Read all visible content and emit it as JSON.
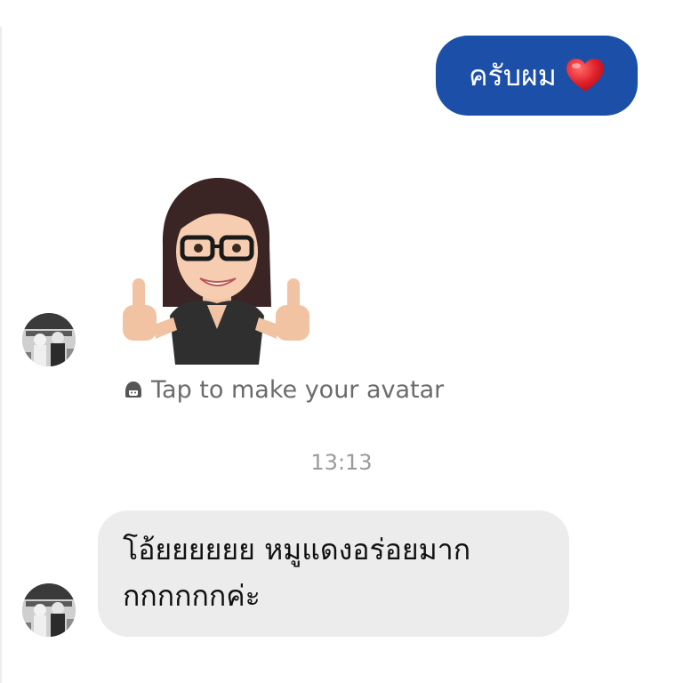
{
  "thread": {
    "sent_message": {
      "text": "ครับผม",
      "emoji_icon": "heart-icon",
      "bubble_color": "#1c4fa8"
    },
    "sticker": {
      "name": "avatar-thumbs-up-sticker"
    },
    "avatar_cta": {
      "icon": "avatar-face-icon",
      "label": "Tap to make your avatar"
    },
    "timestamp": "13:13",
    "received_message": {
      "line1": "โอ้ยยยยยย หมูแดงอร่อยมาก",
      "line2": "กกกกกกค่ะ",
      "bubble_color": "#ececec"
    }
  }
}
